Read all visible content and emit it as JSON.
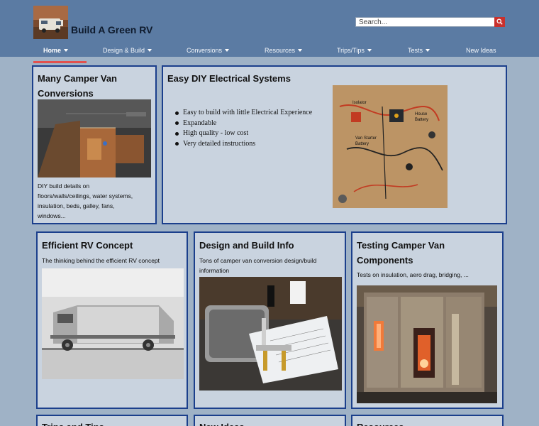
{
  "site": {
    "title": "Build A Green RV",
    "logo_icon": "camper-van-logo"
  },
  "search": {
    "placeholder": "Search...",
    "button_icon": "search-icon"
  },
  "nav": {
    "items": [
      {
        "label": "Home",
        "dropdown": true,
        "active": true
      },
      {
        "label": "Design & Build",
        "dropdown": true
      },
      {
        "label": "Conversions",
        "dropdown": true
      },
      {
        "label": "Resources",
        "dropdown": true
      },
      {
        "label": "Trips/Tips",
        "dropdown": true
      },
      {
        "label": "Tests",
        "dropdown": true
      },
      {
        "label": "New Ideas",
        "dropdown": false
      }
    ]
  },
  "cards": {
    "conversions": {
      "title_line1": "Many Camper Van",
      "title_line2": "Conversions",
      "text_lines": [
        "DIY build details on",
        "floors/walls/ceilings, water systems,",
        "insulation, beds, galley, fans,",
        "windows..."
      ]
    },
    "electrical": {
      "title": "Easy DIY Electrical Systems",
      "bullets": [
        "Easy to build with little Electrical Experience",
        "Expandable",
        "High quality - low cost",
        "Very detailed instructions"
      ],
      "photo_labels": {
        "isolator": "Isolator",
        "house_battery_1": "House",
        "house_battery_2": "Battery",
        "starter_1": "Van Starter",
        "starter_2": "Battery"
      }
    },
    "efficient_rv": {
      "title": "Efficient RV Concept",
      "text": "The thinking behind the efficient RV concept"
    },
    "design_build": {
      "title": "Design and Build Info",
      "text_line1": "Tons of camper van conversion design/build",
      "text_line2": "information"
    },
    "testing": {
      "title_line1": "Testing Camper Van",
      "title_line2": "Components",
      "text": "Tests on insulation, aero drag, bridging, ..."
    },
    "trips": {
      "title": "Trips and Tips"
    },
    "new_ideas": {
      "title": "New Ideas"
    },
    "resources": {
      "title": "Resources"
    }
  },
  "colors": {
    "header_bg": "#5b7ba3",
    "page_bg": "#9fb2c6",
    "card_bg": "#c9d3df",
    "card_border": "#1b3f8c",
    "accent_red": "#e3514e"
  }
}
